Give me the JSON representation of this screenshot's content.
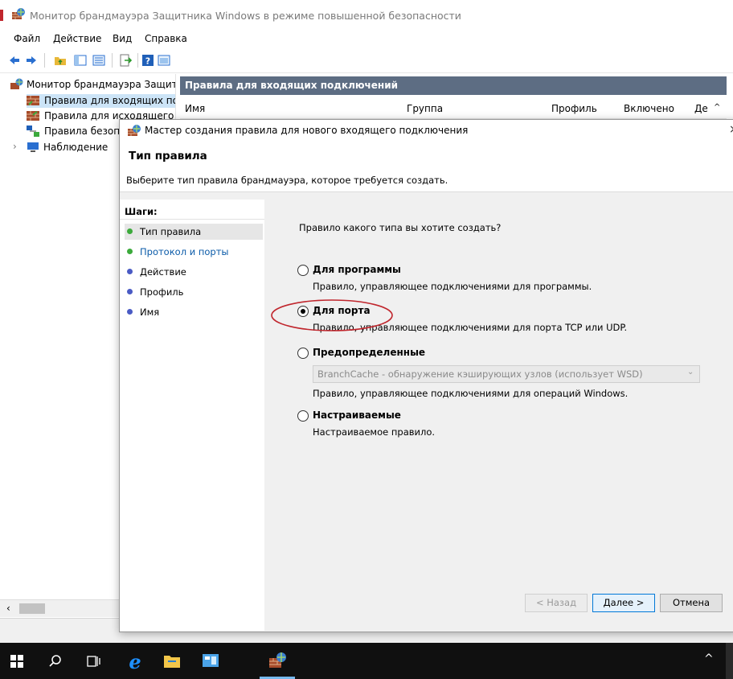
{
  "main_window": {
    "title": "Монитор брандмауэра Защитника Windows в режиме повышенной безопасности",
    "menu": [
      "Файл",
      "Действие",
      "Вид",
      "Справка"
    ]
  },
  "tree": {
    "root": "Монитор брандмауэра Защит",
    "items": [
      "Правила для входящих по,",
      "Правила для исходящего г",
      "Правила безопа",
      "Наблюдение"
    ]
  },
  "panel": {
    "header": "Правила для входящих подключений",
    "columns": [
      "Имя",
      "Группа",
      "Профиль",
      "Включено",
      "Де"
    ]
  },
  "dialog": {
    "title": "Мастер создания правила для нового входящего подключения",
    "heading": "Тип правила",
    "subheading": "Выберите тип правила брандмауэра, которое требуется создать.",
    "steps_label": "Шаги:",
    "steps": [
      {
        "label": "Тип правила",
        "state": "current"
      },
      {
        "label": "Протокол и порты",
        "state": "next"
      },
      {
        "label": "Действие",
        "state": "pending"
      },
      {
        "label": "Профиль",
        "state": "pending"
      },
      {
        "label": "Имя",
        "state": "pending"
      }
    ],
    "question": "Правило какого типа вы хотите создать?",
    "options": [
      {
        "label": "Для программы",
        "desc": "Правило, управляющее подключениями для программы.",
        "selected": false
      },
      {
        "label": "Для порта",
        "desc": "Правило, управляющее подключениями для порта TCP или UDP.",
        "selected": true
      },
      {
        "label": "Предопределенные",
        "desc": "Правило, управляющее подключениями для операций Windows.",
        "selected": false
      },
      {
        "label": "Настраиваемые",
        "desc": "Настраиваемое правило.",
        "selected": false
      }
    ],
    "predefined_select": "BranchCache - обнаружение кэширующих узлов (использует WSD)",
    "buttons": {
      "back": "< Назад",
      "next": "Далее >",
      "cancel": "Отмена"
    }
  },
  "colors": {
    "panel_header_bg": "#5d6d83",
    "step_dot_green": "#3caa3c",
    "step_dot_blue": "#4a5bc4",
    "link_blue": "#0a5aa8",
    "highlight_red": "#c0262d"
  }
}
